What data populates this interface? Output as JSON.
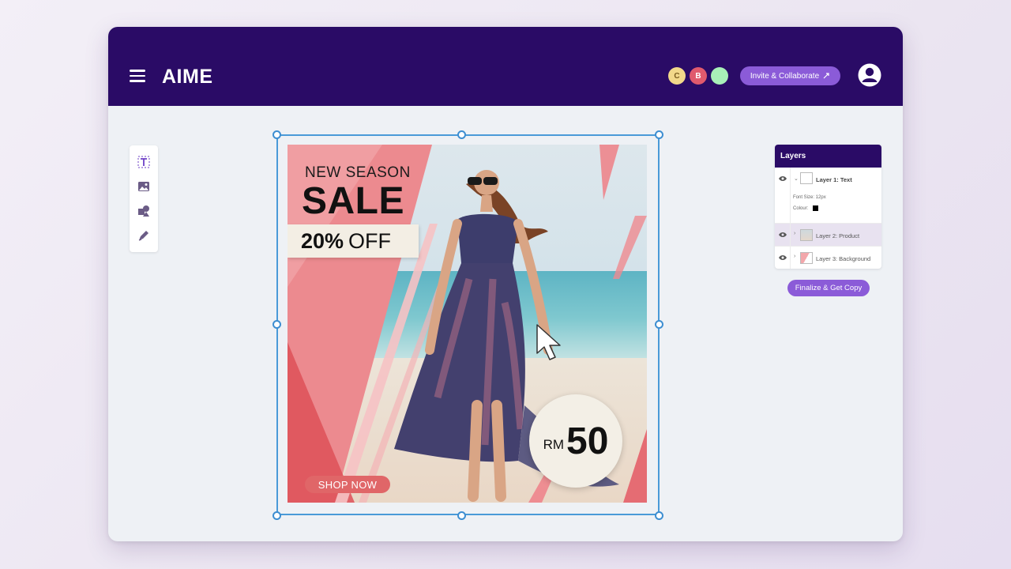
{
  "app": {
    "name": "AIME"
  },
  "header": {
    "collaborators": [
      {
        "initial": "C",
        "color": "#f2d88a"
      },
      {
        "initial": "B",
        "color": "#e05a6d"
      },
      {
        "initial": "",
        "color": "#a8f0b8"
      }
    ],
    "invite_label": "Invite & Collaborate",
    "menu_icon": "hamburger-menu-icon",
    "profile_icon": "user-avatar-icon"
  },
  "toolbox": {
    "tools": [
      {
        "name": "text-tool",
        "icon": "text-icon"
      },
      {
        "name": "image-tool",
        "icon": "image-icon"
      },
      {
        "name": "shapes-tool",
        "icon": "shapes-icon"
      },
      {
        "name": "pen-tool",
        "icon": "pen-icon"
      }
    ]
  },
  "poster": {
    "headline_small": "NEW SEASON",
    "headline_big": "SALE",
    "discount_bold": "20%",
    "discount_rest": "OFF",
    "cta": "SHOP NOW",
    "price_currency": "RM",
    "price_amount": "50",
    "accent_color": "#e56c73"
  },
  "layers_panel": {
    "title": "Layers",
    "layers": [
      {
        "name": "Layer 1: Text",
        "expanded": true,
        "selected": false
      },
      {
        "name": "Layer 2: Product",
        "expanded": false,
        "selected": true
      },
      {
        "name": "Layer 3: Background",
        "expanded": false,
        "selected": false
      }
    ],
    "properties": {
      "font_size": "Font Size: 12px",
      "colour_label": "Colour:",
      "colour_value": "#000000"
    },
    "finalize_label": "Finalize & Get Copy"
  },
  "colors": {
    "header_bg": "#2a0b66",
    "button_purple": "#8b5bd8",
    "selection_blue": "#3d8ed1"
  }
}
